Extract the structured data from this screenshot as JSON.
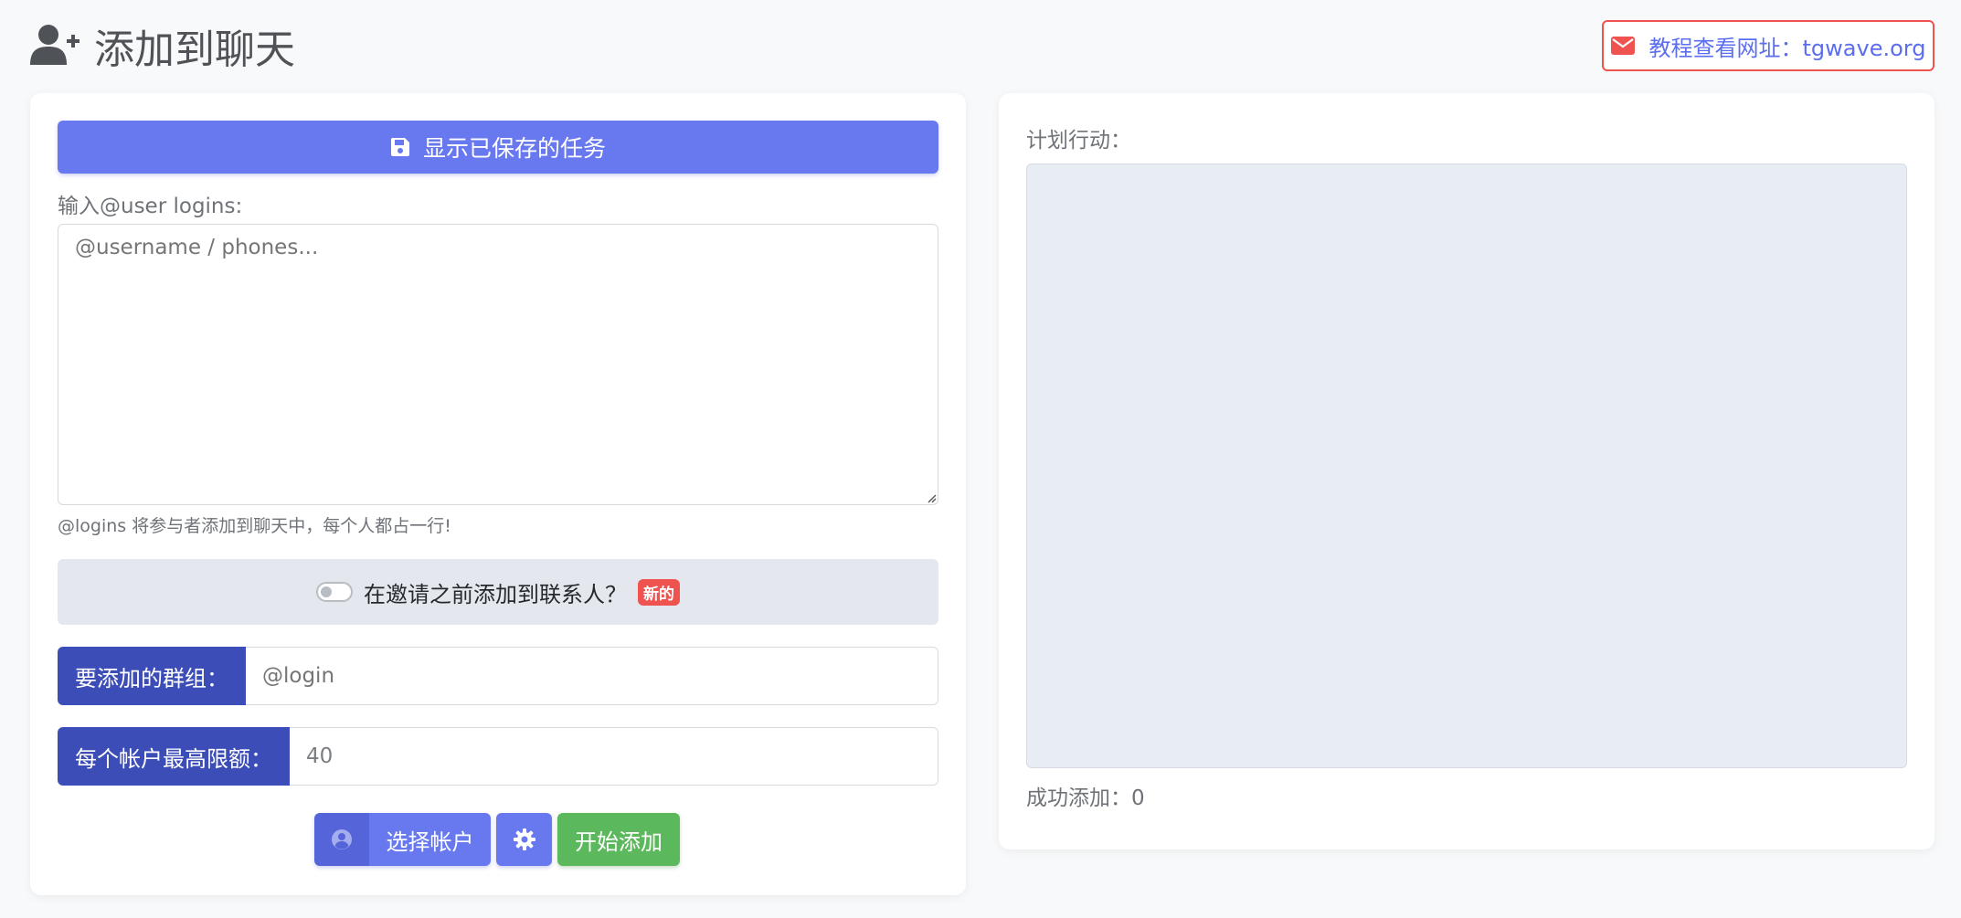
{
  "header": {
    "title": "添加到聊天",
    "tutorial_link": "教程查看网址：tgwave.org"
  },
  "left": {
    "saved_tasks_button": "显示已保存的任务",
    "logins_label": "输入@user logins:",
    "logins_placeholder": "@username / phones...",
    "logins_hint": "@logins 将参与者添加到聊天中，每个人都占一行!",
    "contacts_toggle_label": "在邀请之前添加到联系人？",
    "new_badge": "新的",
    "group_label": "要添加的群组：",
    "group_placeholder": "@login",
    "limit_label": "每个帐户最高限额：",
    "limit_value": "40",
    "select_account_button": "选择帐户",
    "start_button": "开始添加"
  },
  "right": {
    "plan_label": "计划行动：",
    "success_label": "成功添加：",
    "success_count": "0"
  },
  "colors": {
    "primary": "#6878ef",
    "primary_dark": "#3d4db7",
    "danger": "#ef5350",
    "success": "#5cb85c"
  },
  "icons": {
    "title": "user-plus-icon",
    "tutorial": "envelope-icon",
    "saved": "floppy-disk-icon",
    "account": "user-circle-icon",
    "settings": "gear-icon"
  }
}
